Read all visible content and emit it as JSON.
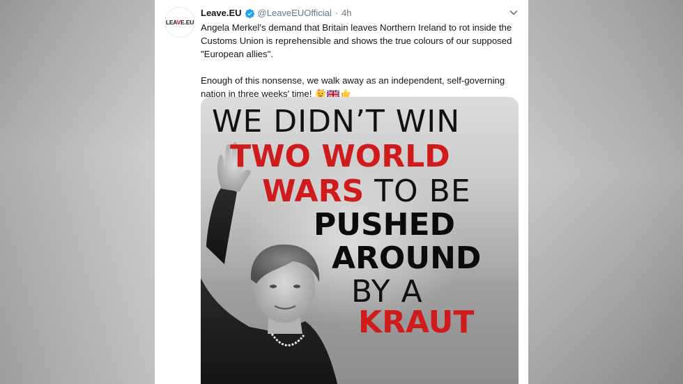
{
  "tweet": {
    "avatar_text_left": "LEA",
    "avatar_text_tick": "V",
    "avatar_text_right": "E.EU",
    "display_name": "Leave.EU",
    "handle": "@LeaveEUOfficial",
    "separator": "·",
    "timestamp": "4h",
    "verified_icon": "verified-badge-icon",
    "menu_icon": "chevron-down-icon",
    "body_paragraph_1": "Angela Merkel’s demand that Britain leaves Northern Ireland to rot inside the Customs Union is reprehensible and shows the true colours of our supposed \"European allies\".",
    "body_paragraph_2": "Enough of this nonsense, we walk away as an independent, self-governing nation in three weeks' time!",
    "emojis": [
      "party-face-emoji",
      "union-jack-flag-emoji",
      "thumbs-up-emoji"
    ]
  },
  "poster": {
    "line1": "WE DIDN’T WIN",
    "line2": "TWO WORLD",
    "line3_red": "WARS",
    "line3_black": " TO BE",
    "line4": "PUSHED",
    "line5": "AROUND",
    "line6": "BY A",
    "line7": "KRAUT"
  },
  "colors": {
    "accent_red": "#cf1b1b",
    "verified_blue": "#1da1f2",
    "text_primary": "#14171a",
    "text_secondary": "#657786"
  }
}
